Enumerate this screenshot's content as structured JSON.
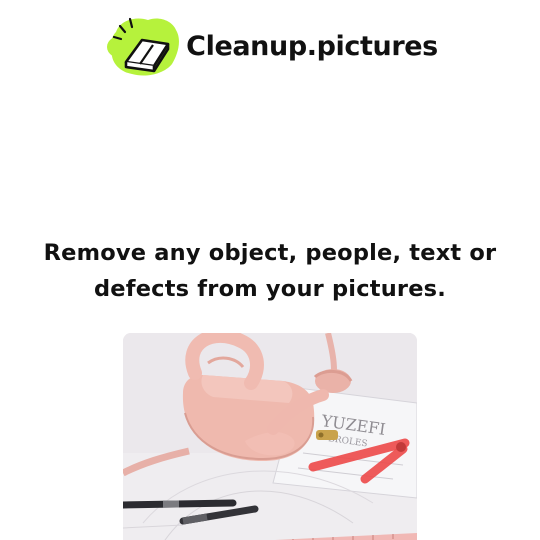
{
  "header": {
    "logo_icon": "eraser-logo-icon",
    "brand_name": "Cleanup.pictures",
    "accent_color": "#b6f23c"
  },
  "hero": {
    "headline_line1": "Remove any object, people, text or",
    "headline_line2": "defects from your pictures."
  },
  "demo_image": {
    "subject": "demo-photo-pink-handbag",
    "magazine_text_1": "YUZEFI",
    "magazine_text_2": "BROLES",
    "highlight_color": "#ee4a4a"
  }
}
